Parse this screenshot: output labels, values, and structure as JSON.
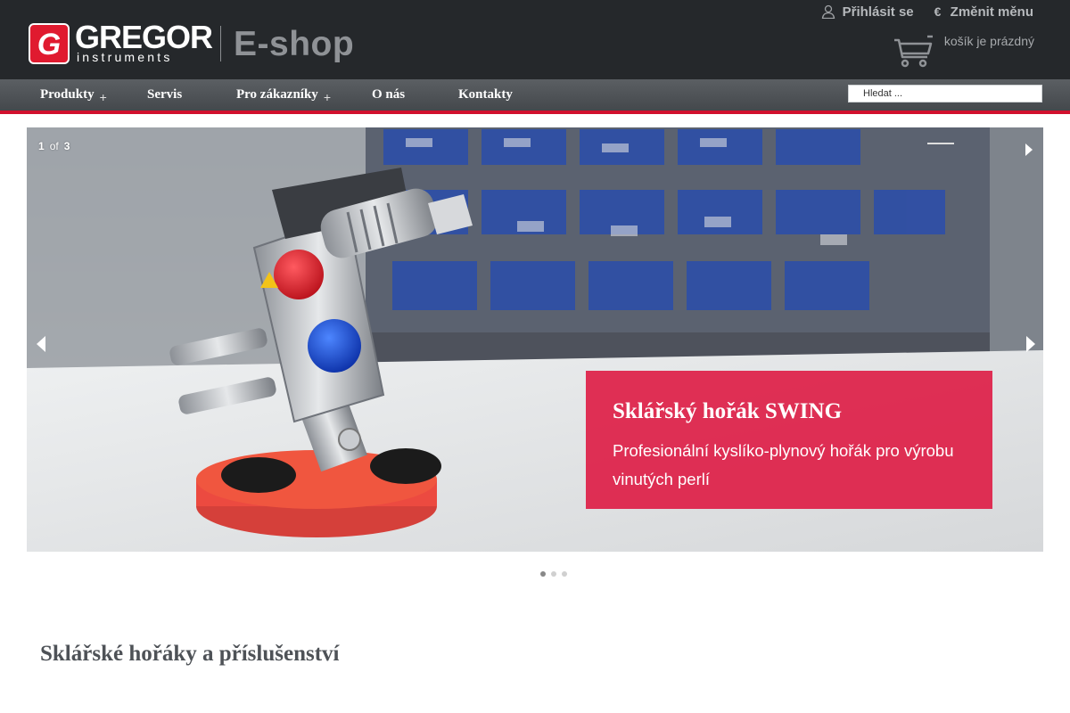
{
  "header": {
    "logo_text": "GREGOR",
    "logo_subtext": "instruments",
    "eshop_label": "E-shop",
    "login_label": "Přihlásit se",
    "currency_symbol": "€",
    "currency_label": "Změnit měnu",
    "cart_status": "košík je prázdný",
    "icons": {
      "login": "user-icon",
      "currency": "euro-icon",
      "cart": "cart-icon"
    }
  },
  "nav": {
    "items": [
      {
        "label": "Produkty",
        "has_submenu": true
      },
      {
        "label": "Servis",
        "has_submenu": false
      },
      {
        "label": "Pro zákazníky",
        "has_submenu": true
      },
      {
        "label": "O nás",
        "has_submenu": false
      },
      {
        "label": "Kontakty",
        "has_submenu": false
      }
    ],
    "submenu_marker": "+",
    "search_placeholder": "Hledat ..."
  },
  "slider": {
    "current": "1",
    "of_label": "of",
    "total": "3",
    "caption_title": "Sklářský hořák SWING",
    "caption_text": "Profesionální kyslíko-plynový hořák pro výrobu vinutých perlí",
    "dots_count": 3,
    "active_dot": 1
  },
  "main": {
    "section_heading": "Sklářské hořáky a příslušenství"
  },
  "colors": {
    "header_bg": "#25282b",
    "nav_bg": "#4f5357",
    "accent_red": "#d1112e",
    "caption_bg": "#de1b44"
  }
}
